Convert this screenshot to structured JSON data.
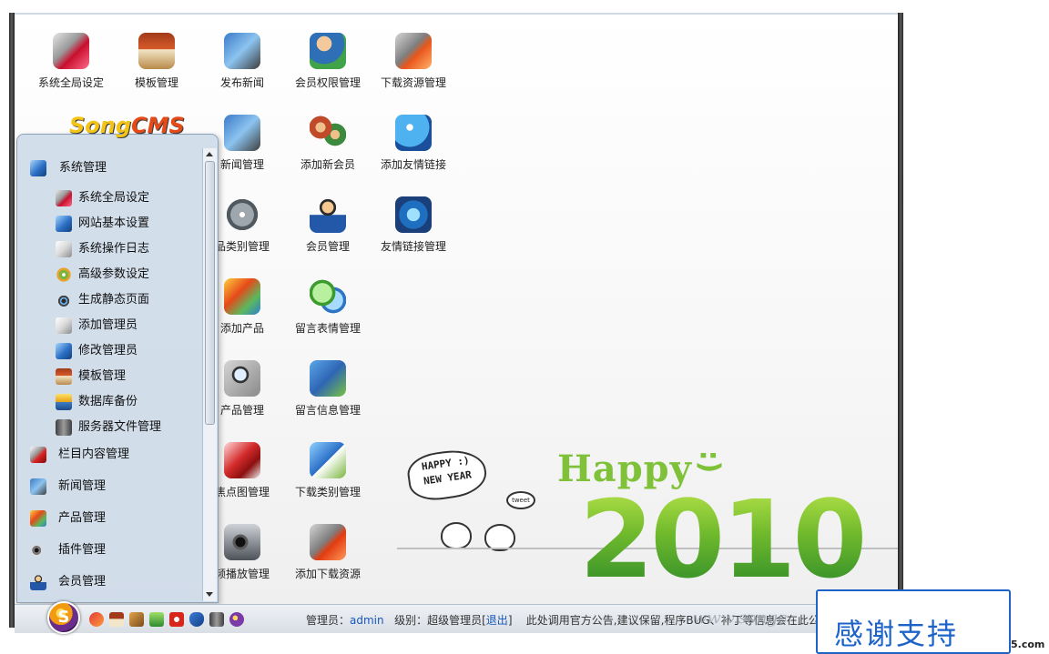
{
  "desktop_icons": [
    {
      "label": "系统全局设定",
      "icon": "global-settings-icon"
    },
    {
      "label": "模板管理",
      "icon": "house-icon"
    },
    {
      "label": "发布新闻",
      "icon": "publish-news-icon"
    },
    {
      "label": "会员权限管理",
      "icon": "member-permission-icon"
    },
    {
      "label": "下载资源管理",
      "icon": "download-resource-icon"
    },
    {
      "label": "新闻管理",
      "icon": "news-manage-icon"
    },
    {
      "label": "添加新会员",
      "icon": "add-member-icon"
    },
    {
      "label": "添加友情链接",
      "icon": "add-link-icon"
    },
    {
      "label": "品类别管理",
      "icon": "product-category-icon"
    },
    {
      "label": "会员管理",
      "icon": "member-manage-icon"
    },
    {
      "label": "友情链接管理",
      "icon": "link-manage-icon"
    },
    {
      "label": "添加产品",
      "icon": "add-product-icon"
    },
    {
      "label": "留言表情管理",
      "icon": "message-emoji-icon"
    },
    {
      "label": "产品管理",
      "icon": "product-manage-icon"
    },
    {
      "label": "留言信息管理",
      "icon": "message-info-icon"
    },
    {
      "label": "焦点图管理",
      "icon": "focus-image-icon"
    },
    {
      "label": "下载类别管理",
      "icon": "download-category-icon"
    },
    {
      "label": "频播放管理",
      "icon": "video-manage-icon"
    },
    {
      "label": "添加下载资源",
      "icon": "add-download-icon"
    }
  ],
  "start_menu": {
    "logo": {
      "part1": "Song",
      "part2": "CMS"
    },
    "header": "系统管理",
    "submenu": [
      "系统全局设定",
      "网站基本设置",
      "系统操作日志",
      "高级参数设定",
      "生成静态页面",
      "添加管理员",
      "修改管理员",
      "模板管理",
      "数据库备份",
      "服务器文件管理"
    ],
    "categories": [
      "栏目内容管理",
      "新闻管理",
      "产品管理",
      "插件管理",
      "会员管理"
    ]
  },
  "banner": {
    "happy": "Happy",
    "smile": ":)",
    "year": "2010",
    "bubble_line1": "HAPPY :)",
    "bubble_line2": "NEW YEAR",
    "tweet": "tweet"
  },
  "taskbar": {
    "start_letter": "S",
    "admin_label": "管理员：",
    "admin_name": "admin",
    "level_label": "级别：",
    "level_value": "超级管理员",
    "logout_open": "[",
    "logout": "退出",
    "logout_close": "]",
    "notice": "此处调用官方公告,建议保留,程序BUG、补丁等信息会在此公",
    "watermark": "www.songc"
  },
  "overlay": {
    "thanks": "感谢支持",
    "domain_tail": "5.com"
  },
  "colors": {
    "accent_blue": "#1e64c8",
    "menu_arrow": "#c0001a",
    "year_green": "#6fb92c"
  }
}
